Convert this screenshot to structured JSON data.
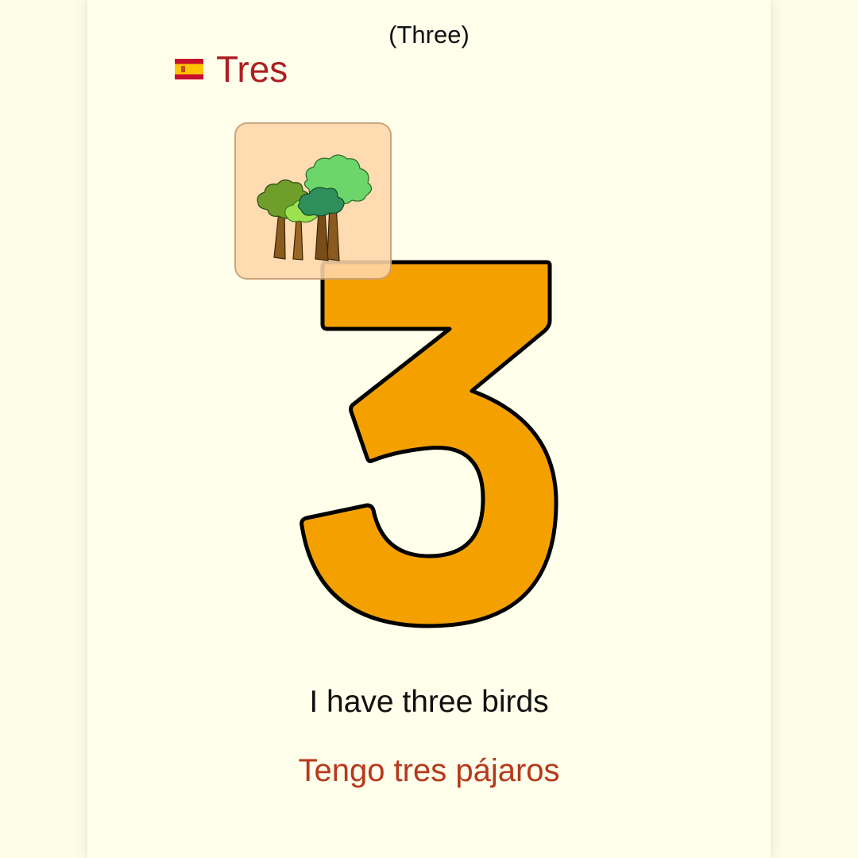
{
  "card": {
    "subtitle": "(Three)",
    "flag_icon": "spain-flag-icon",
    "title": "Tres",
    "picture_icon": "trees-icon",
    "numeral": "3",
    "sentence_en": "I have three birds",
    "sentence_es": "Tengo tres pájaros"
  },
  "colors": {
    "background": "#fefee8",
    "title": "#ad1f23",
    "numeral_fill": "#f4a100",
    "sentence_es": "#b5391c",
    "tile": "#ffd6aa"
  }
}
